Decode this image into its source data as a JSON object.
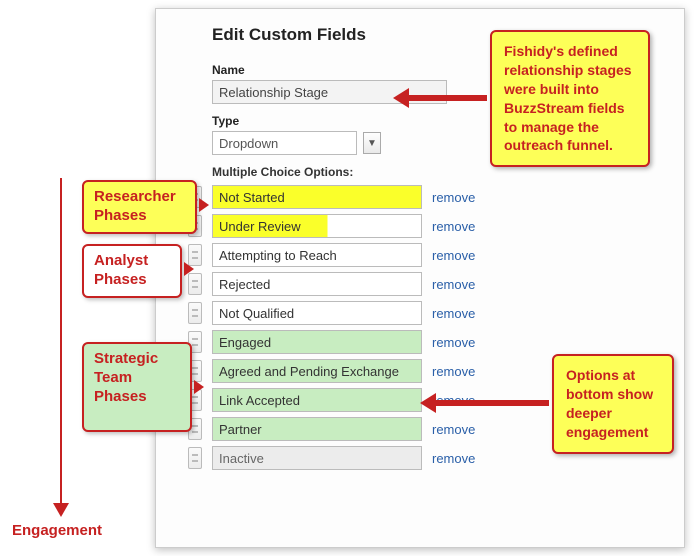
{
  "dialog": {
    "title": "Edit Custom Fields",
    "name_label": "Name",
    "name_value": "Relationship Stage",
    "type_label": "Type",
    "type_value": "Dropdown",
    "mco_label": "Multiple Choice Options:",
    "remove_label": "remove"
  },
  "options": [
    {
      "label": "Not Started",
      "hl": "yellow-full"
    },
    {
      "label": "Under Review",
      "hl": "yellow-part"
    },
    {
      "label": "Attempting to Reach",
      "hl": "none"
    },
    {
      "label": "Rejected",
      "hl": "none"
    },
    {
      "label": "Not Qualified",
      "hl": "none"
    },
    {
      "label": "Engaged",
      "hl": "green"
    },
    {
      "label": "Agreed and Pending Exchange",
      "hl": "green"
    },
    {
      "label": "Link Accepted",
      "hl": "green"
    },
    {
      "label": "Partner",
      "hl": "green"
    },
    {
      "label": "Inactive",
      "hl": "gray"
    }
  ],
  "annotations": {
    "researcher": "Researcher Phases",
    "analyst": "Analyst Phases",
    "strategic": "Strategic Team Phases",
    "engagement": "Engagement",
    "top_right": "Fishidy's defined relationship stages were built into BuzzStream fields to manage the outreach funnel.",
    "bottom_right": "Options at bottom show deeper engagement"
  }
}
